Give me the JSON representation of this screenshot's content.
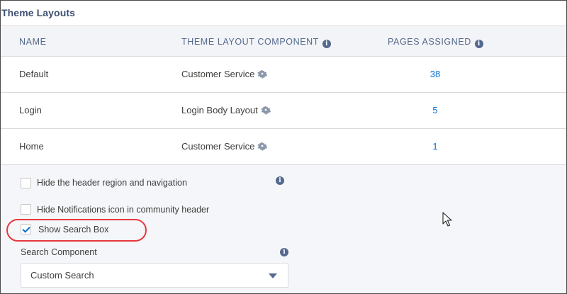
{
  "panel": {
    "title": "Theme Layouts"
  },
  "table": {
    "columns": [
      {
        "label": "NAME",
        "has_info": false
      },
      {
        "label": "THEME LAYOUT COMPONENT",
        "has_info": true
      },
      {
        "label": "PAGES ASSIGNED",
        "has_info": true
      }
    ],
    "rows": [
      {
        "name": "Default",
        "component": "Customer Service",
        "pages": "38"
      },
      {
        "name": "Login",
        "component": "Login Body Layout",
        "pages": "5"
      },
      {
        "name": "Home",
        "component": "Customer Service",
        "pages": "1"
      }
    ]
  },
  "settings": {
    "hide_header": {
      "label": "Hide the header region and navigation",
      "checked": false
    },
    "hide_notifications": {
      "label": "Hide Notifications icon in community header",
      "checked": false
    },
    "show_search": {
      "label": "Show Search Box",
      "checked": true
    },
    "search_component": {
      "label": "Search Component",
      "value": "Custom Search"
    }
  },
  "icons": {
    "info": "info-icon",
    "gear": "gear-icon",
    "caret": "chevron-down-icon",
    "cursor": "mouse-cursor-icon"
  },
  "colors": {
    "link": "#0070d2",
    "header_text": "#54698d",
    "highlight": "#e8373f"
  }
}
